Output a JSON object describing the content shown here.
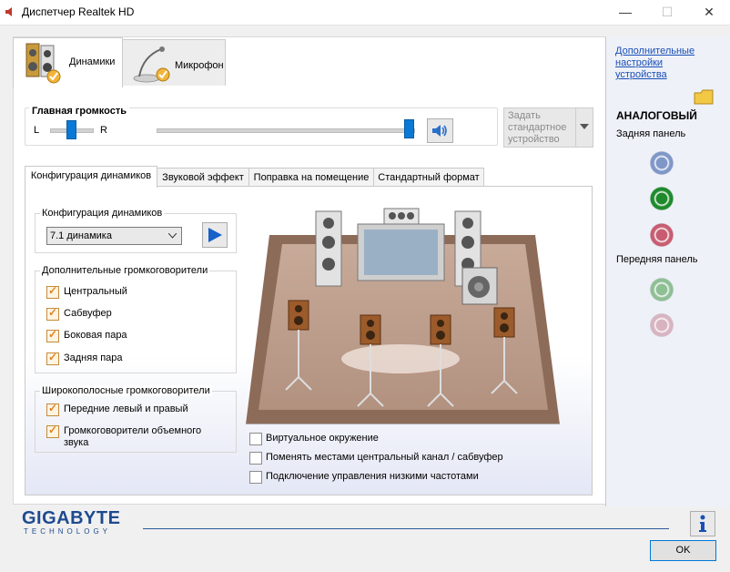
{
  "window": {
    "title": "Диспетчер Realtek HD",
    "minimize_glyph": "—",
    "maximize_glyph": "☐",
    "close_glyph": "✕"
  },
  "device_tabs": [
    {
      "label": "Динамики",
      "icon": "speakers-icon",
      "active": true
    },
    {
      "label": "Микрофон",
      "icon": "microphone-icon",
      "active": false
    }
  ],
  "volume": {
    "title": "Главная громкость",
    "left_label": "L",
    "right_label": "R",
    "balance": 0.5,
    "level": 1.0
  },
  "default_device": {
    "label": "Задать стандартное устройство"
  },
  "sub_tabs": [
    "Конфигурация динамиков",
    "Звуковой эффект",
    "Поправка на помещение",
    "Стандартный формат"
  ],
  "speaker_config": {
    "group_title": "Конфигурация динамиков",
    "selected": "7.1 динамика"
  },
  "optional_speakers": {
    "title": "Дополнительные громкоговорители",
    "items": [
      {
        "label": "Центральный",
        "checked": true
      },
      {
        "label": "Сабвуфер",
        "checked": true
      },
      {
        "label": "Боковая пара",
        "checked": true
      },
      {
        "label": "Задняя пара",
        "checked": true
      }
    ]
  },
  "fullrange_speakers": {
    "title": "Широкополосные громкоговорители",
    "items": [
      {
        "label": "Передние левый и правый",
        "checked": true
      },
      {
        "label": "Громкоговорители объемного звука",
        "checked": true
      }
    ]
  },
  "options": [
    {
      "label": "Виртуальное окружение",
      "checked": false
    },
    {
      "label": "Поменять местами центральный канал / сабвуфер",
      "checked": false
    },
    {
      "label": "Подключение управления низкими частотами",
      "checked": false
    }
  ],
  "right_panel": {
    "link": "Дополнительные настройки устройства",
    "analog_title": "АНАЛОГОВЫЙ",
    "back_panel": "Задняя панель",
    "front_panel": "Передняя панель",
    "back_jacks": [
      "#7f97c8",
      "#1e8a2c",
      "#c85c70"
    ],
    "front_jacks": [
      "#8fbf95",
      "#d8b3c0"
    ]
  },
  "brand": {
    "name": "GIGABYTE",
    "sub": "TECHNOLOGY"
  },
  "ok_label": "OK",
  "colors": {
    "accent": "#0a79d6",
    "link": "#1a4fb7",
    "check": "#e0841f"
  }
}
